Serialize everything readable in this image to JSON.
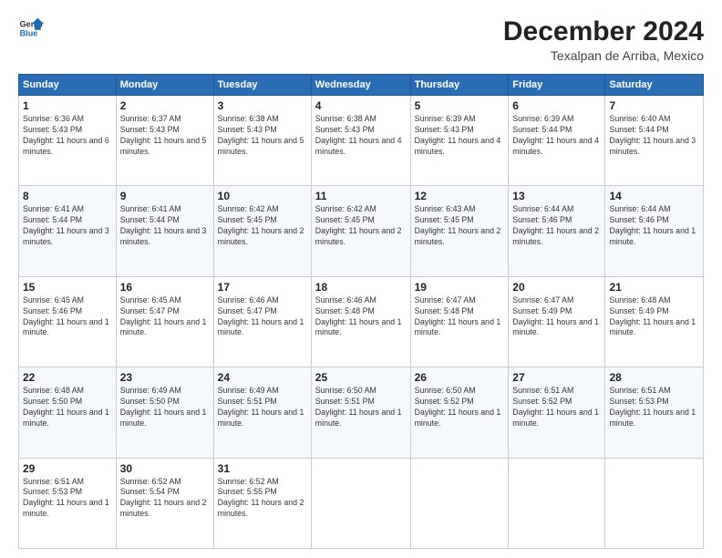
{
  "logo": {
    "line1": "General",
    "line2": "Blue"
  },
  "title": "December 2024",
  "subtitle": "Texalpan de Arriba, Mexico",
  "days_of_week": [
    "Sunday",
    "Monday",
    "Tuesday",
    "Wednesday",
    "Thursday",
    "Friday",
    "Saturday"
  ],
  "weeks": [
    [
      {
        "day": "1",
        "sunrise": "6:36 AM",
        "sunset": "5:43 PM",
        "daylight": "11 hours and 6 minutes."
      },
      {
        "day": "2",
        "sunrise": "6:37 AM",
        "sunset": "5:43 PM",
        "daylight": "11 hours and 5 minutes."
      },
      {
        "day": "3",
        "sunrise": "6:38 AM",
        "sunset": "5:43 PM",
        "daylight": "11 hours and 5 minutes."
      },
      {
        "day": "4",
        "sunrise": "6:38 AM",
        "sunset": "5:43 PM",
        "daylight": "11 hours and 4 minutes."
      },
      {
        "day": "5",
        "sunrise": "6:39 AM",
        "sunset": "5:43 PM",
        "daylight": "11 hours and 4 minutes."
      },
      {
        "day": "6",
        "sunrise": "6:39 AM",
        "sunset": "5:44 PM",
        "daylight": "11 hours and 4 minutes."
      },
      {
        "day": "7",
        "sunrise": "6:40 AM",
        "sunset": "5:44 PM",
        "daylight": "11 hours and 3 minutes."
      }
    ],
    [
      {
        "day": "8",
        "sunrise": "6:41 AM",
        "sunset": "5:44 PM",
        "daylight": "11 hours and 3 minutes."
      },
      {
        "day": "9",
        "sunrise": "6:41 AM",
        "sunset": "5:44 PM",
        "daylight": "11 hours and 3 minutes."
      },
      {
        "day": "10",
        "sunrise": "6:42 AM",
        "sunset": "5:45 PM",
        "daylight": "11 hours and 2 minutes."
      },
      {
        "day": "11",
        "sunrise": "6:42 AM",
        "sunset": "5:45 PM",
        "daylight": "11 hours and 2 minutes."
      },
      {
        "day": "12",
        "sunrise": "6:43 AM",
        "sunset": "5:45 PM",
        "daylight": "11 hours and 2 minutes."
      },
      {
        "day": "13",
        "sunrise": "6:44 AM",
        "sunset": "5:46 PM",
        "daylight": "11 hours and 2 minutes."
      },
      {
        "day": "14",
        "sunrise": "6:44 AM",
        "sunset": "5:46 PM",
        "daylight": "11 hours and 1 minute."
      }
    ],
    [
      {
        "day": "15",
        "sunrise": "6:45 AM",
        "sunset": "5:46 PM",
        "daylight": "11 hours and 1 minute."
      },
      {
        "day": "16",
        "sunrise": "6:45 AM",
        "sunset": "5:47 PM",
        "daylight": "11 hours and 1 minute."
      },
      {
        "day": "17",
        "sunrise": "6:46 AM",
        "sunset": "5:47 PM",
        "daylight": "11 hours and 1 minute."
      },
      {
        "day": "18",
        "sunrise": "6:46 AM",
        "sunset": "5:48 PM",
        "daylight": "11 hours and 1 minute."
      },
      {
        "day": "19",
        "sunrise": "6:47 AM",
        "sunset": "5:48 PM",
        "daylight": "11 hours and 1 minute."
      },
      {
        "day": "20",
        "sunrise": "6:47 AM",
        "sunset": "5:49 PM",
        "daylight": "11 hours and 1 minute."
      },
      {
        "day": "21",
        "sunrise": "6:48 AM",
        "sunset": "5:49 PM",
        "daylight": "11 hours and 1 minute."
      }
    ],
    [
      {
        "day": "22",
        "sunrise": "6:48 AM",
        "sunset": "5:50 PM",
        "daylight": "11 hours and 1 minute."
      },
      {
        "day": "23",
        "sunrise": "6:49 AM",
        "sunset": "5:50 PM",
        "daylight": "11 hours and 1 minute."
      },
      {
        "day": "24",
        "sunrise": "6:49 AM",
        "sunset": "5:51 PM",
        "daylight": "11 hours and 1 minute."
      },
      {
        "day": "25",
        "sunrise": "6:50 AM",
        "sunset": "5:51 PM",
        "daylight": "11 hours and 1 minute."
      },
      {
        "day": "26",
        "sunrise": "6:50 AM",
        "sunset": "5:52 PM",
        "daylight": "11 hours and 1 minute."
      },
      {
        "day": "27",
        "sunrise": "6:51 AM",
        "sunset": "5:52 PM",
        "daylight": "11 hours and 1 minute."
      },
      {
        "day": "28",
        "sunrise": "6:51 AM",
        "sunset": "5:53 PM",
        "daylight": "11 hours and 1 minute."
      }
    ],
    [
      {
        "day": "29",
        "sunrise": "6:51 AM",
        "sunset": "5:53 PM",
        "daylight": "11 hours and 1 minute."
      },
      {
        "day": "30",
        "sunrise": "6:52 AM",
        "sunset": "5:54 PM",
        "daylight": "11 hours and 2 minutes."
      },
      {
        "day": "31",
        "sunrise": "6:52 AM",
        "sunset": "5:55 PM",
        "daylight": "11 hours and 2 minutes."
      },
      null,
      null,
      null,
      null
    ]
  ],
  "labels": {
    "sunrise": "Sunrise:",
    "sunset": "Sunset:",
    "daylight": "Daylight:"
  }
}
